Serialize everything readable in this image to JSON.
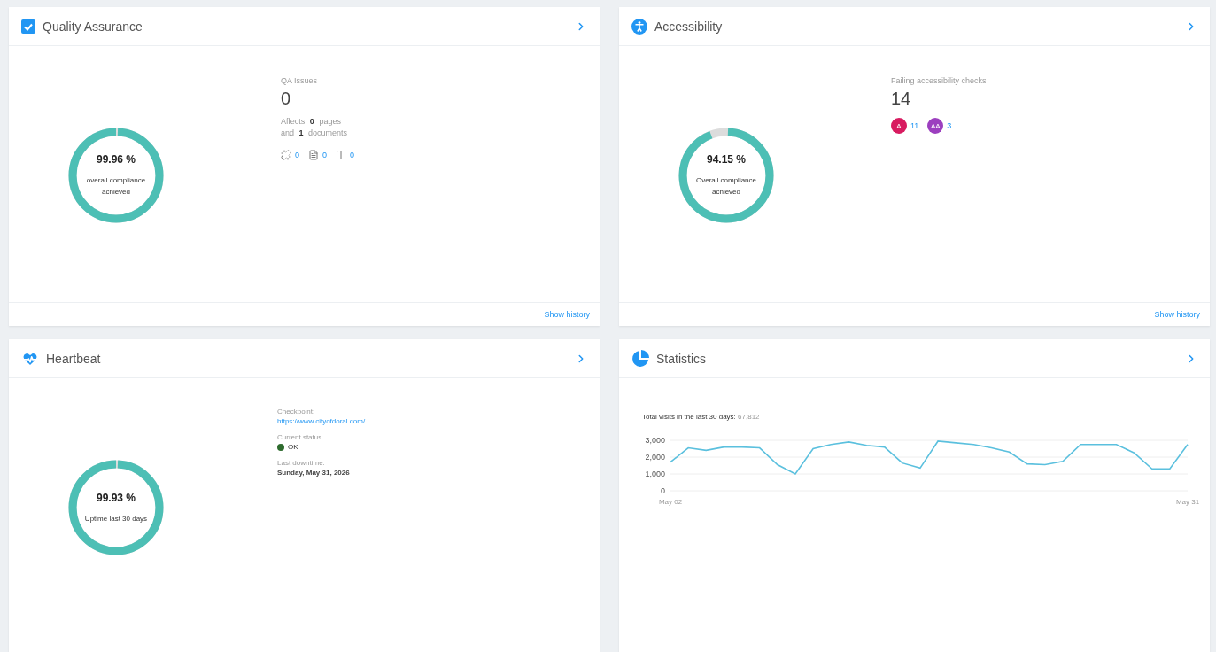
{
  "cards": [
    {
      "kind": "qa",
      "title": "Quality Assurance",
      "score": {
        "value": "99.96 %",
        "caption": "overall compliance achieved",
        "level": 0.9996
      },
      "stat_label": "QA Issues",
      "stat_value": "0",
      "affects": [
        "Affects **0** pages",
        "and **1** documents"
      ],
      "issue_counts": [
        {
          "kind": "link",
          "count": "0"
        },
        {
          "kind": "file",
          "count": "0"
        },
        {
          "kind": "layout",
          "count": "0"
        }
      ],
      "footer_link": "Show history"
    },
    {
      "kind": "accessibility",
      "title": "Accessibility",
      "score": {
        "value": "94.15 %",
        "caption": "Overall compliance achieved",
        "level": 0.9415
      },
      "stat_label": "Failing accessibility checks",
      "stat_value": "14",
      "levels": [
        {
          "badge": "A",
          "count": "11",
          "color": "#d81b60"
        },
        {
          "badge": "AA",
          "count": "3",
          "color": "#9c3fbf"
        }
      ],
      "footer_link": "Show history"
    },
    {
      "kind": "heartbeat",
      "title": "Heartbeat",
      "score": {
        "value": "99.93 %",
        "caption": "Uptime last 30 days",
        "level": 0.9993
      },
      "fields": [
        {
          "kind": "link",
          "label": "Checkpoint:",
          "value": "https://www.cityofdoral.com/"
        },
        {
          "kind": "status",
          "label": "Current status",
          "value": "OK",
          "color": "#2e6b2e"
        },
        {
          "kind": "text",
          "label": "Last downtime:",
          "value": "Sunday, May 31, 2026"
        }
      ]
    },
    {
      "kind": "statistics",
      "title": "Statistics",
      "summary_label": "Total visits in the last 30 days:",
      "summary_value": "67,812",
      "chart_data": {
        "type": "line",
        "ylim": [
          0,
          3000
        ],
        "yticks": [
          {
            "value": 0,
            "label": "0"
          },
          {
            "value": 1000,
            "label": "1,000"
          },
          {
            "value": 2000,
            "label": "2,000"
          },
          {
            "value": 3000,
            "label": "3,000"
          }
        ],
        "categories": [
          "May 02",
          null,
          null,
          null,
          null,
          null,
          null,
          null,
          null,
          null,
          null,
          null,
          null,
          null,
          null,
          null,
          null,
          null,
          null,
          null,
          null,
          null,
          null,
          null,
          null,
          null,
          null,
          null,
          null,
          "May 31"
        ],
        "series": [
          {
            "color": "#5bc0de",
            "values": [
              1700,
              2550,
              2400,
              2600,
              2600,
              2550,
              1550,
              1000,
              2500,
              2750,
              2900,
              2700,
              2600,
              1650,
              1350,
              2950,
              2850,
              2750,
              2550,
              2300,
              1600,
              1550,
              1750,
              2750,
              2750,
              2750,
              2250,
              1300,
              1300,
              2750
            ]
          }
        ]
      }
    }
  ]
}
